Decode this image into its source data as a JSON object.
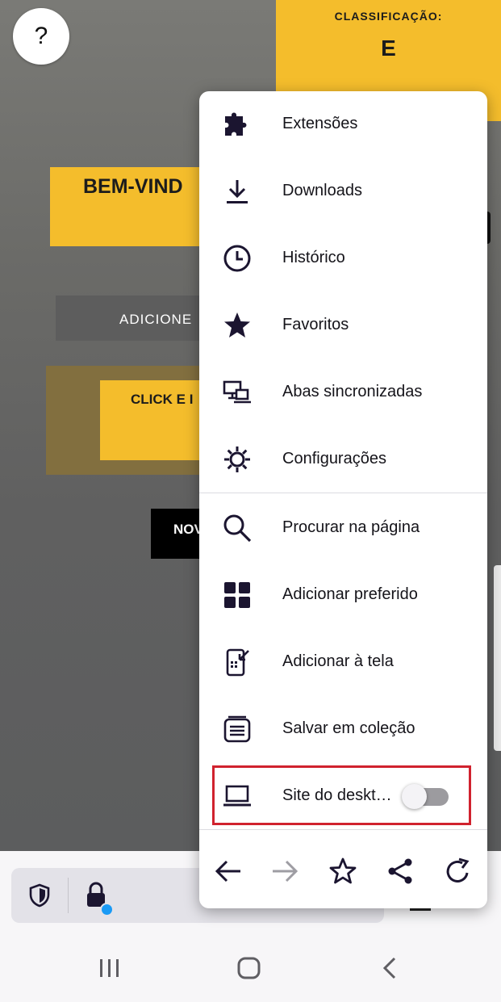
{
  "page": {
    "help_label": "?",
    "rating_label": "CLASSIFICAÇÃO:",
    "rating_value": "E",
    "welcome_text": "BEM-VIND",
    "add_button": "ADICIONE",
    "click_text": "CLICK E I",
    "nov_button": "NOV"
  },
  "menu": {
    "items": [
      {
        "label": "Extensões",
        "icon": "puzzle-icon"
      },
      {
        "label": "Downloads",
        "icon": "download-icon"
      },
      {
        "label": "Histórico",
        "icon": "clock-icon"
      },
      {
        "label": "Favoritos",
        "icon": "star-icon"
      },
      {
        "label": "Abas sincronizadas",
        "icon": "synced-tabs-icon"
      },
      {
        "label": "Configurações",
        "icon": "gear-icon"
      },
      {
        "label": "Procurar na página",
        "icon": "search-icon"
      },
      {
        "label": "Adicionar preferido",
        "icon": "grid-icon"
      },
      {
        "label": "Adicionar à tela",
        "icon": "add-to-homescreen-icon"
      },
      {
        "label": "Salvar em coleção",
        "icon": "collection-icon"
      },
      {
        "label": "Site do deskt…",
        "icon": "laptop-icon"
      }
    ],
    "desktop_site_enabled": false,
    "bottom_icons": [
      "back-arrow-icon",
      "forward-arrow-icon",
      "star-outline-icon",
      "share-icon",
      "reload-icon"
    ]
  },
  "colors": {
    "accent_yellow": "#f4bd2c",
    "highlight_red": "#d0222e",
    "icon_dark": "#1b1530",
    "dot_blue": "#1a9af5"
  },
  "toolbar_icons": [
    "shield-icon",
    "lock-icon"
  ],
  "navbar_icons": [
    "recent-apps-icon",
    "home-icon",
    "back-icon"
  ]
}
